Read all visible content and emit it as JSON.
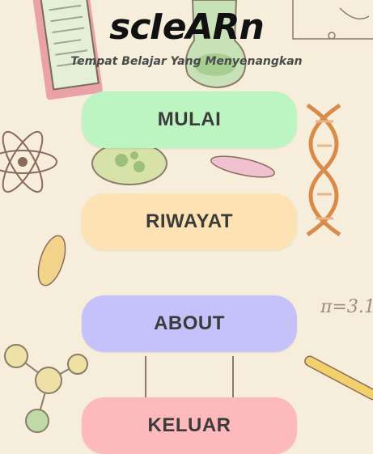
{
  "app": {
    "title": "scIeARn",
    "subtitle": "Tempat Belajar Yang Menyenangkan"
  },
  "menu": {
    "mulai": {
      "label": "MULAI",
      "color": "#bdf5c2"
    },
    "riwayat": {
      "label": "RIWAYAT",
      "color": "#fde3b4"
    },
    "about": {
      "label": "ABOUT",
      "color": "#c5c2fb"
    },
    "keluar": {
      "label": "KELUAR",
      "color": "#fdb9bc"
    }
  },
  "background": {
    "formula": "π=3.1",
    "theme_icons": [
      "notebook-icon",
      "flask-icon",
      "atom-icon",
      "petri-dish-icon",
      "bacteria-icon",
      "dna-helix-icon",
      "molecule-icon",
      "test-tube-icon",
      "microorganism-icon"
    ]
  }
}
